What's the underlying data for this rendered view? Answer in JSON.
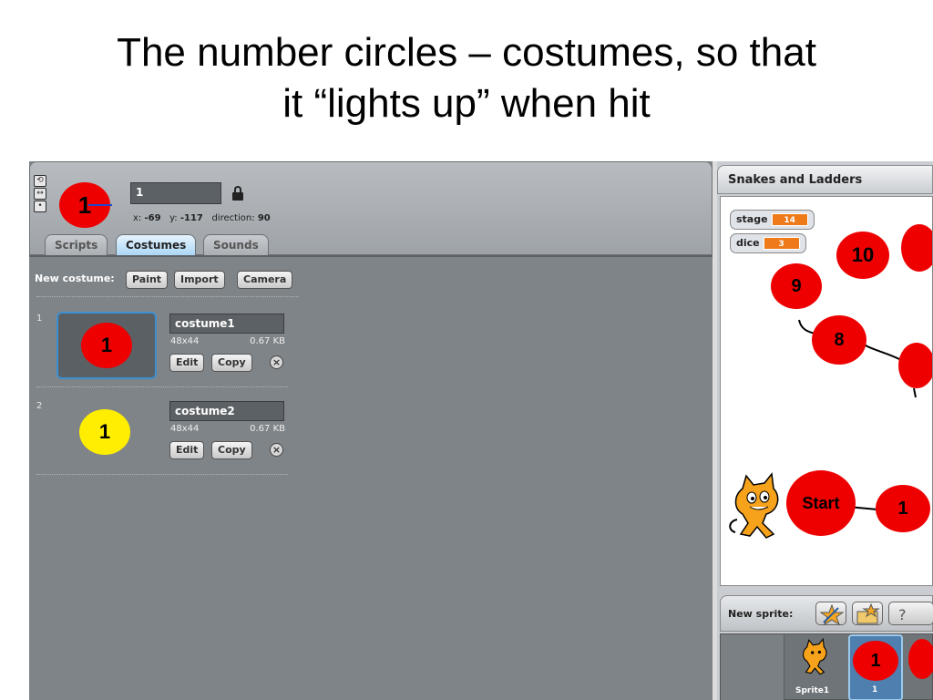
{
  "slide": {
    "title_line1": "The number circles – costumes, so that",
    "title_line2": "it “lights up” when hit"
  },
  "sprite_header": {
    "thumb_label": "1",
    "name_value": "1",
    "x_label": "x:",
    "x_value": "-69",
    "y_label": "y:",
    "y_value": "-117",
    "direction_label": "direction:",
    "direction_value": "90",
    "icons": [
      "rotate-icon",
      "flip-icon",
      "no-rotate-icon",
      "lock-icon"
    ]
  },
  "tabs": [
    {
      "label": "Scripts",
      "active": false
    },
    {
      "label": "Costumes",
      "active": true
    },
    {
      "label": "Sounds",
      "active": false
    }
  ],
  "costumes_toolbar": {
    "label": "New costume:",
    "paint": "Paint",
    "import": "Import",
    "camera": "Camera"
  },
  "costumes": [
    {
      "index": "1",
      "name": "costume1",
      "size": "48x44",
      "bytes": "0.67 KB",
      "thumb_label": "1",
      "color": "#ee0000",
      "edit": "Edit",
      "copy": "Copy",
      "selected": true
    },
    {
      "index": "2",
      "name": "costume2",
      "size": "48x44",
      "bytes": "0.67 KB",
      "thumb_label": "1",
      "color": "#ffee00",
      "edit": "Edit",
      "copy": "Copy",
      "selected": false
    }
  ],
  "stage": {
    "title": "Snakes and Ladders",
    "monitors": [
      {
        "name": "stage",
        "value": "14"
      },
      {
        "name": "dice",
        "value": "3"
      }
    ],
    "board_labels": {
      "c10": "10",
      "c9": "9",
      "c8": "8",
      "start": "Start",
      "c1": "1"
    }
  },
  "sprite_pane": {
    "new_sprite_label": "New sprite:",
    "sprite_name": "Sprite1",
    "tile2_label": "1",
    "tile2_caption": "1"
  },
  "colors": {
    "accent_orange": "#ee7a1a",
    "circle_red": "#ee0000",
    "circle_yellow": "#ffee00",
    "selected_blue": "#3c8fd0"
  }
}
